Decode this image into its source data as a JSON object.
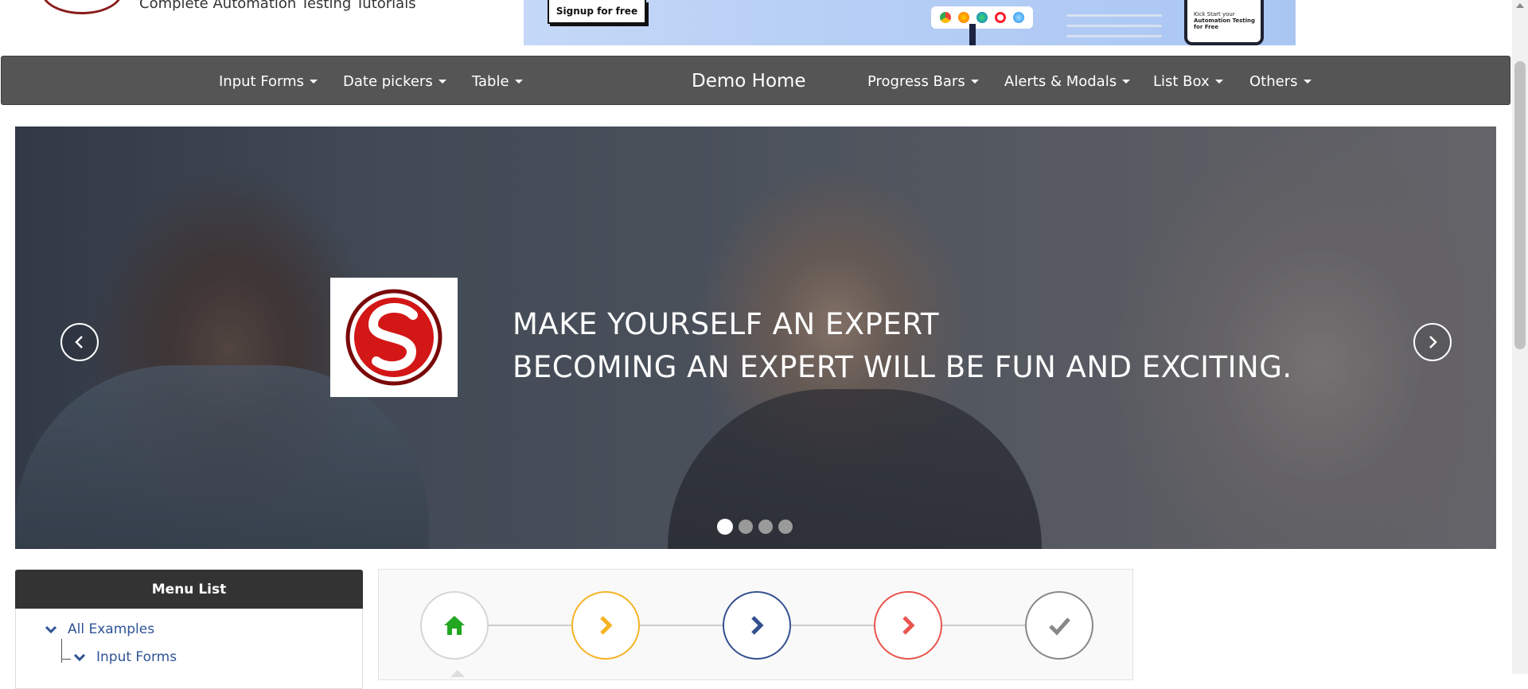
{
  "header": {
    "tagline": "Complete Automation Testing Tutorials",
    "ad": {
      "signup_label": "Signup for free",
      "phone_line1": "Kick Start your",
      "phone_line2": "Automation Testing",
      "phone_line3": "for Free"
    }
  },
  "nav": {
    "items_left": [
      {
        "label": "Input Forms"
      },
      {
        "label": "Date pickers"
      },
      {
        "label": "Table"
      }
    ],
    "home": "Demo Home",
    "items_right": [
      {
        "label": "Progress Bars"
      },
      {
        "label": "Alerts & Modals"
      },
      {
        "label": "List Box"
      },
      {
        "label": "Others"
      }
    ]
  },
  "carousel": {
    "line1": "MAKE YOURSELF AN EXPERT",
    "line2": "BECOMING AN EXPERT WILL BE FUN AND EXCITING.",
    "slide_count": 4,
    "active_index": 0
  },
  "menu": {
    "title": "Menu List",
    "items": [
      {
        "label": "All Examples"
      },
      {
        "label": "Input Forms"
      }
    ]
  },
  "stepper": {
    "steps": [
      {
        "icon": "home-icon",
        "color": "#22a722"
      },
      {
        "icon": "chevron-right-icon",
        "color": "#f5b324"
      },
      {
        "icon": "chevron-right-icon",
        "color": "#34508f"
      },
      {
        "icon": "chevron-right-icon",
        "color": "#e8554e"
      },
      {
        "icon": "check-icon",
        "color": "#888888"
      }
    ]
  },
  "colors": {
    "nav_bg": "#555555",
    "menu_header_bg": "#333333",
    "link": "#2f5496",
    "brand_red": "#c81414"
  }
}
